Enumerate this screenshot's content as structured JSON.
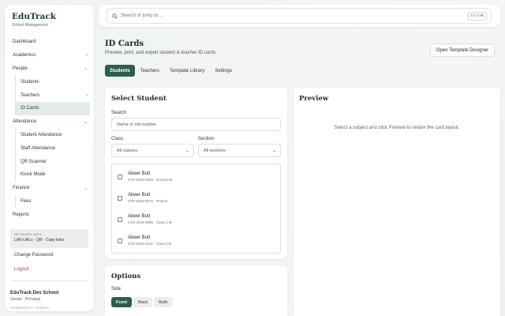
{
  "sidebar": {
    "brand": "EduTrack",
    "brand_sub": "School Management",
    "items": [
      {
        "label": "Dashboard"
      },
      {
        "label": "Academics"
      },
      {
        "label": "People"
      },
      {
        "label": "Students"
      },
      {
        "label": "Teachers"
      },
      {
        "label": "ID Cards"
      },
      {
        "label": "Attendance"
      },
      {
        "label": "Student Attendance"
      },
      {
        "label": "Staff Attendance"
      },
      {
        "label": "QR Scanner"
      },
      {
        "label": "Kiosk Mode"
      },
      {
        "label": "Finance"
      },
      {
        "label": "Fees"
      },
      {
        "label": "Reports"
      }
    ],
    "network_info_title": "NETWORK INFO",
    "network_info_value": "LAN URLs · QR · Copy links",
    "change_password": "Change Password",
    "logout": "Logout",
    "org_name": "EduTrack Dev School",
    "user": "Jawad · Principal",
    "powered_by": "POWERED BY ONKIRO",
    "logout_color": "#c0392b"
  },
  "topbar": {
    "search_placeholder": "Search or jump to…",
    "shortcut": "Ctrl+K"
  },
  "page": {
    "title": "ID Cards",
    "subtitle": "Preview, print, and export student & teacher ID cards.",
    "designer_button": "Open Template Designer",
    "tabs": [
      "Students",
      "Teachers",
      "Template Library",
      "Settings"
    ],
    "accent": "#2c5e50"
  },
  "select_student": {
    "title": "Select Student",
    "search_label": "Search",
    "search_placeholder": "Name or roll number",
    "class_label": "Class",
    "class_value": "All classes",
    "section_label": "Section",
    "section_value": "All sections",
    "students": [
      {
        "name": "Abeer Butt",
        "meta": "STD-2025-0056 · Nursery-B"
      },
      {
        "name": "Abeer Butt",
        "meta": "STD-2025-0076 · Prep-B"
      },
      {
        "name": "Abeer Butt",
        "meta": "STD-2025-0096 · Class 1-B"
      },
      {
        "name": "Abeer Butt",
        "meta": "STD-2025-0116 · Class 2-B"
      }
    ]
  },
  "preview": {
    "title": "Preview",
    "message": "Select a subject and click Preview to render the card layout."
  },
  "options": {
    "title": "Options",
    "side_label": "Side",
    "sides": [
      "Front",
      "Back",
      "Both"
    ]
  }
}
